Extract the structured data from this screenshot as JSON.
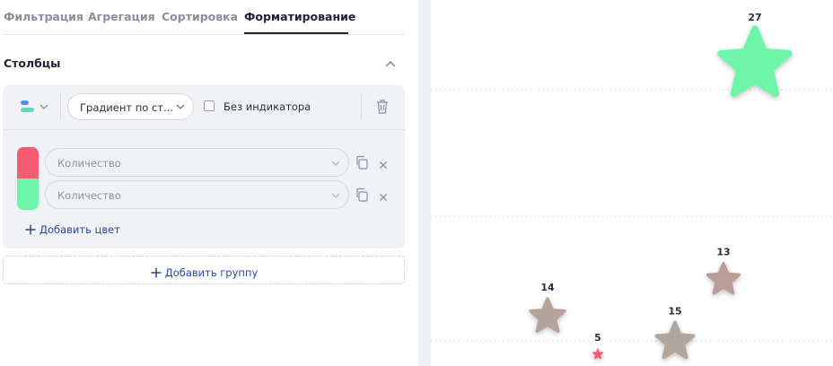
{
  "tabs": [
    {
      "label": "Фильтрация",
      "active": false
    },
    {
      "label": "Агрегация",
      "active": false
    },
    {
      "label": "Сортировка",
      "active": false
    },
    {
      "label": "Форматирование",
      "active": true
    }
  ],
  "section": {
    "title": "Столбцы",
    "collapse_icon": "chevron-up-icon"
  },
  "group": {
    "type_icon": "bar-type-icon",
    "mode_select": "Градиент по ст...",
    "no_indicator_checked": false,
    "no_indicator_label": "Без индикатора",
    "delete_icon": "trash-icon",
    "colors": [
      {
        "swatch": "#f75a73",
        "field": "Количество"
      },
      {
        "swatch": "#6df5aa",
        "field": "Количество"
      }
    ],
    "add_color_label": "Добавить цвет"
  },
  "add_group_label": "Добавить группу",
  "colors": {
    "accent": "#2b46a3",
    "gradient_low": "#f75a73",
    "gradient_high": "#6df5aa",
    "panel_bg": "#f1f2f6"
  },
  "chart_data": {
    "type": "scatter",
    "marker": "star",
    "grid": true,
    "points": [
      {
        "label": "27",
        "value": 27
      },
      {
        "label": "13",
        "value": 13
      },
      {
        "label": "14",
        "value": 14
      },
      {
        "label": "15",
        "value": 15
      },
      {
        "label": "5",
        "value": 5
      }
    ]
  }
}
